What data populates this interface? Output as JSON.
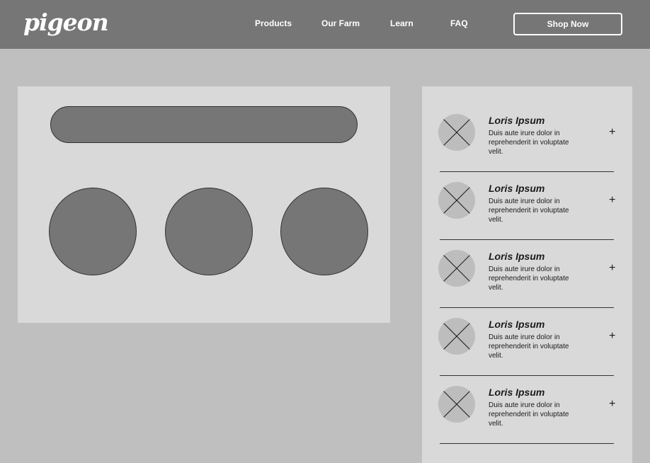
{
  "header": {
    "logo": "pigeon",
    "nav": [
      "Products",
      "Our Farm",
      "Learn",
      "FAQ"
    ],
    "cta_label": "Shop Now"
  },
  "list": {
    "items": [
      {
        "title": "Loris Ipsum",
        "text": "Duis aute irure dolor in reprehenderit in voluptate velit.",
        "action": "+"
      },
      {
        "title": "Loris Ipsum",
        "text": "Duis aute irure dolor in reprehenderit in voluptate velit.",
        "action": "+"
      },
      {
        "title": "Loris Ipsum",
        "text": "Duis aute irure dolor in reprehenderit in voluptate velit.",
        "action": "+"
      },
      {
        "title": "Loris Ipsum",
        "text": "Duis aute irure dolor in reprehenderit in voluptate velit.",
        "action": "+"
      },
      {
        "title": "Loris Ipsum",
        "text": "Duis aute irure dolor in reprehenderit in voluptate velit.",
        "action": "+"
      }
    ]
  }
}
